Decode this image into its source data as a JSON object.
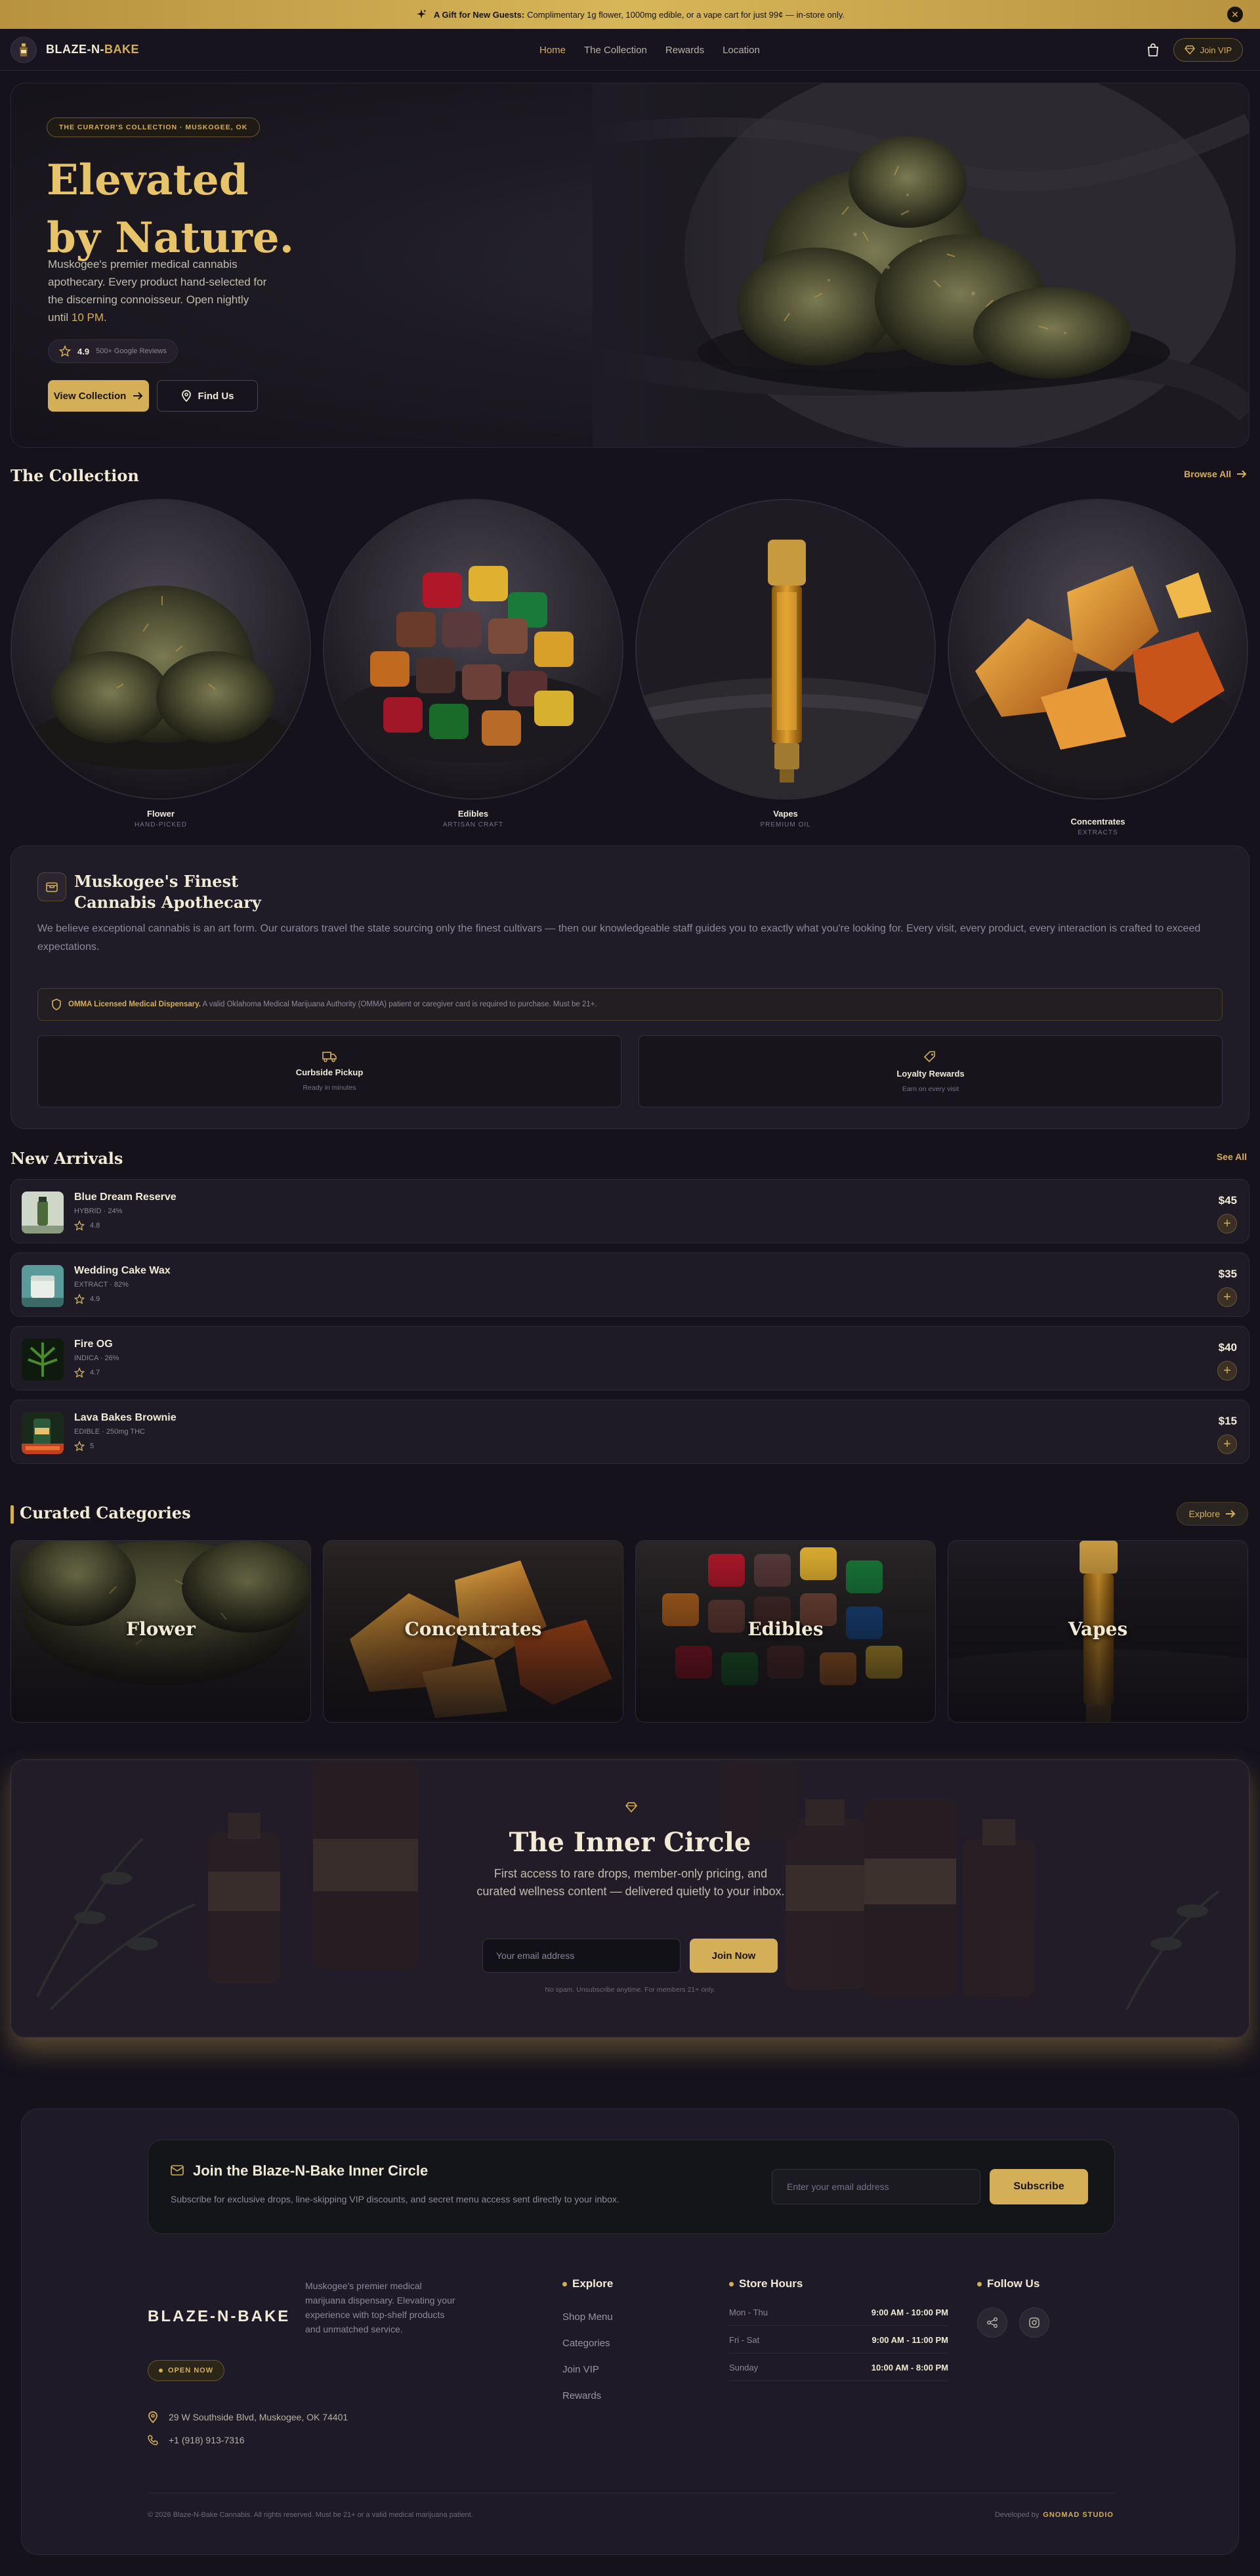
{
  "announcement": {
    "bold": "A Gift for New Guests:",
    "text": "Complimentary 1g flower, 1000mg edible, or a vape cart for just 99¢ — in-store only."
  },
  "nav": {
    "brand_main": "BLAZE-N-",
    "brand_accent": "BAKE",
    "links": [
      "Home",
      "The Collection",
      "Rewards",
      "Location"
    ],
    "vip_label": "Join VIP"
  },
  "hero": {
    "tag": "THE CURATOR'S COLLECTION · MUSKOGEE, OK",
    "title_line1": "Elevated",
    "title_line2": "by Nature.",
    "desc": "Muskogee's premier medical cannabis apothecary. Every product hand-selected for the discerning connoisseur. Open nightly until",
    "desc_highlight": "10 PM.",
    "rating": "4.9",
    "reviews": "500+ Google Reviews",
    "cta_primary": "View Collection",
    "cta_secondary": "Find Us"
  },
  "collection": {
    "title": "The Collection",
    "browse": "Browse All",
    "items": [
      {
        "name": "Flower",
        "sub": "HAND-PICKED"
      },
      {
        "name": "Edibles",
        "sub": "ARTISAN CRAFT"
      },
      {
        "name": "Vapes",
        "sub": "PREMIUM OIL"
      },
      {
        "name": "Concentrates",
        "sub": "EXTRACTS"
      }
    ]
  },
  "about": {
    "title_line1": "Muskogee's Finest",
    "title_line2": "Cannabis Apothecary",
    "body": "We believe exceptional cannabis is an art form. Our curators travel the state sourcing only the finest cultivars — then our knowledgeable staff guides you to exactly what you're looking for. Every visit, every product, every interaction is crafted to exceed expectations.",
    "license_bold": "OMMA Licensed Medical Dispensary.",
    "license_text": "A valid Oklahoma Medical Marijuana Authority (OMMA) patient or caregiver card is required to purchase. Must be 21+.",
    "features": [
      {
        "title": "Curbside Pickup",
        "sub": "Ready in minutes"
      },
      {
        "title": "Loyalty Rewards",
        "sub": "Earn on every visit"
      }
    ]
  },
  "arrivals": {
    "title": "New Arrivals",
    "see_all": "See All",
    "products": [
      {
        "name": "Blue Dream Reserve",
        "meta": "HYBRID · 24%",
        "rating": "4.8",
        "price": "$45"
      },
      {
        "name": "Wedding Cake Wax",
        "meta": "EXTRACT · 82%",
        "rating": "4.9",
        "price": "$35"
      },
      {
        "name": "Fire OG",
        "meta": "INDICA · 26%",
        "rating": "4.7",
        "price": "$40"
      },
      {
        "name": "Lava Bakes Brownie",
        "meta": "EDIBLE · 250mg THC",
        "rating": "5",
        "price": "$15"
      }
    ]
  },
  "curated": {
    "title": "Curated Categories",
    "explore": "Explore",
    "cards": [
      "Flower",
      "Concentrates",
      "Edibles",
      "Vapes"
    ]
  },
  "inner_circle": {
    "title": "The Inner Circle",
    "desc": "First access to rare drops, member-only pricing, and curated wellness content — delivered quietly to your inbox.",
    "placeholder": "Your email address",
    "button": "Join Now",
    "fine": "No spam. Unsubscribe anytime. For members 21+ only."
  },
  "footer": {
    "sub_title": "Join the Blaze-N-Bake Inner Circle",
    "sub_desc": "Subscribe for exclusive drops, line-skipping VIP discounts, and secret menu access sent directly to your inbox.",
    "sub_placeholder": "Enter your email address",
    "sub_button": "Subscribe",
    "brand": "BLAZE-N-BAKE",
    "about": "Muskogee's premier medical marijuana dispensary. Elevating your experience with top-shelf products and unmatched service.",
    "open": "OPEN NOW",
    "address": "29 W Southside Blvd, Muskogee, OK 74401",
    "phone": "+1 (918) 913-7316",
    "explore_title": "Explore",
    "explore_links": [
      "Shop Menu",
      "Categories",
      "Join VIP",
      "Rewards"
    ],
    "hours_title": "Store Hours",
    "hours": [
      {
        "day": "Mon - Thu",
        "time": "9:00 AM - 10:00 PM"
      },
      {
        "day": "Fri - Sat",
        "time": "9:00 AM - 11:00 PM"
      },
      {
        "day": "Sunday",
        "time": "10:00 AM - 8:00 PM"
      }
    ],
    "follow_title": "Follow Us",
    "copyright": "© 2026 Blaze-N-Bake Cannabis. All rights reserved. Must be 21+ or a valid medical marijuana patient.",
    "dev_prefix": "Developed by",
    "dev_name": "GNOMAD STUDIO"
  },
  "colors": {
    "gold": "#d4af57",
    "bg": "#15121c",
    "card": "#1f1b26"
  }
}
